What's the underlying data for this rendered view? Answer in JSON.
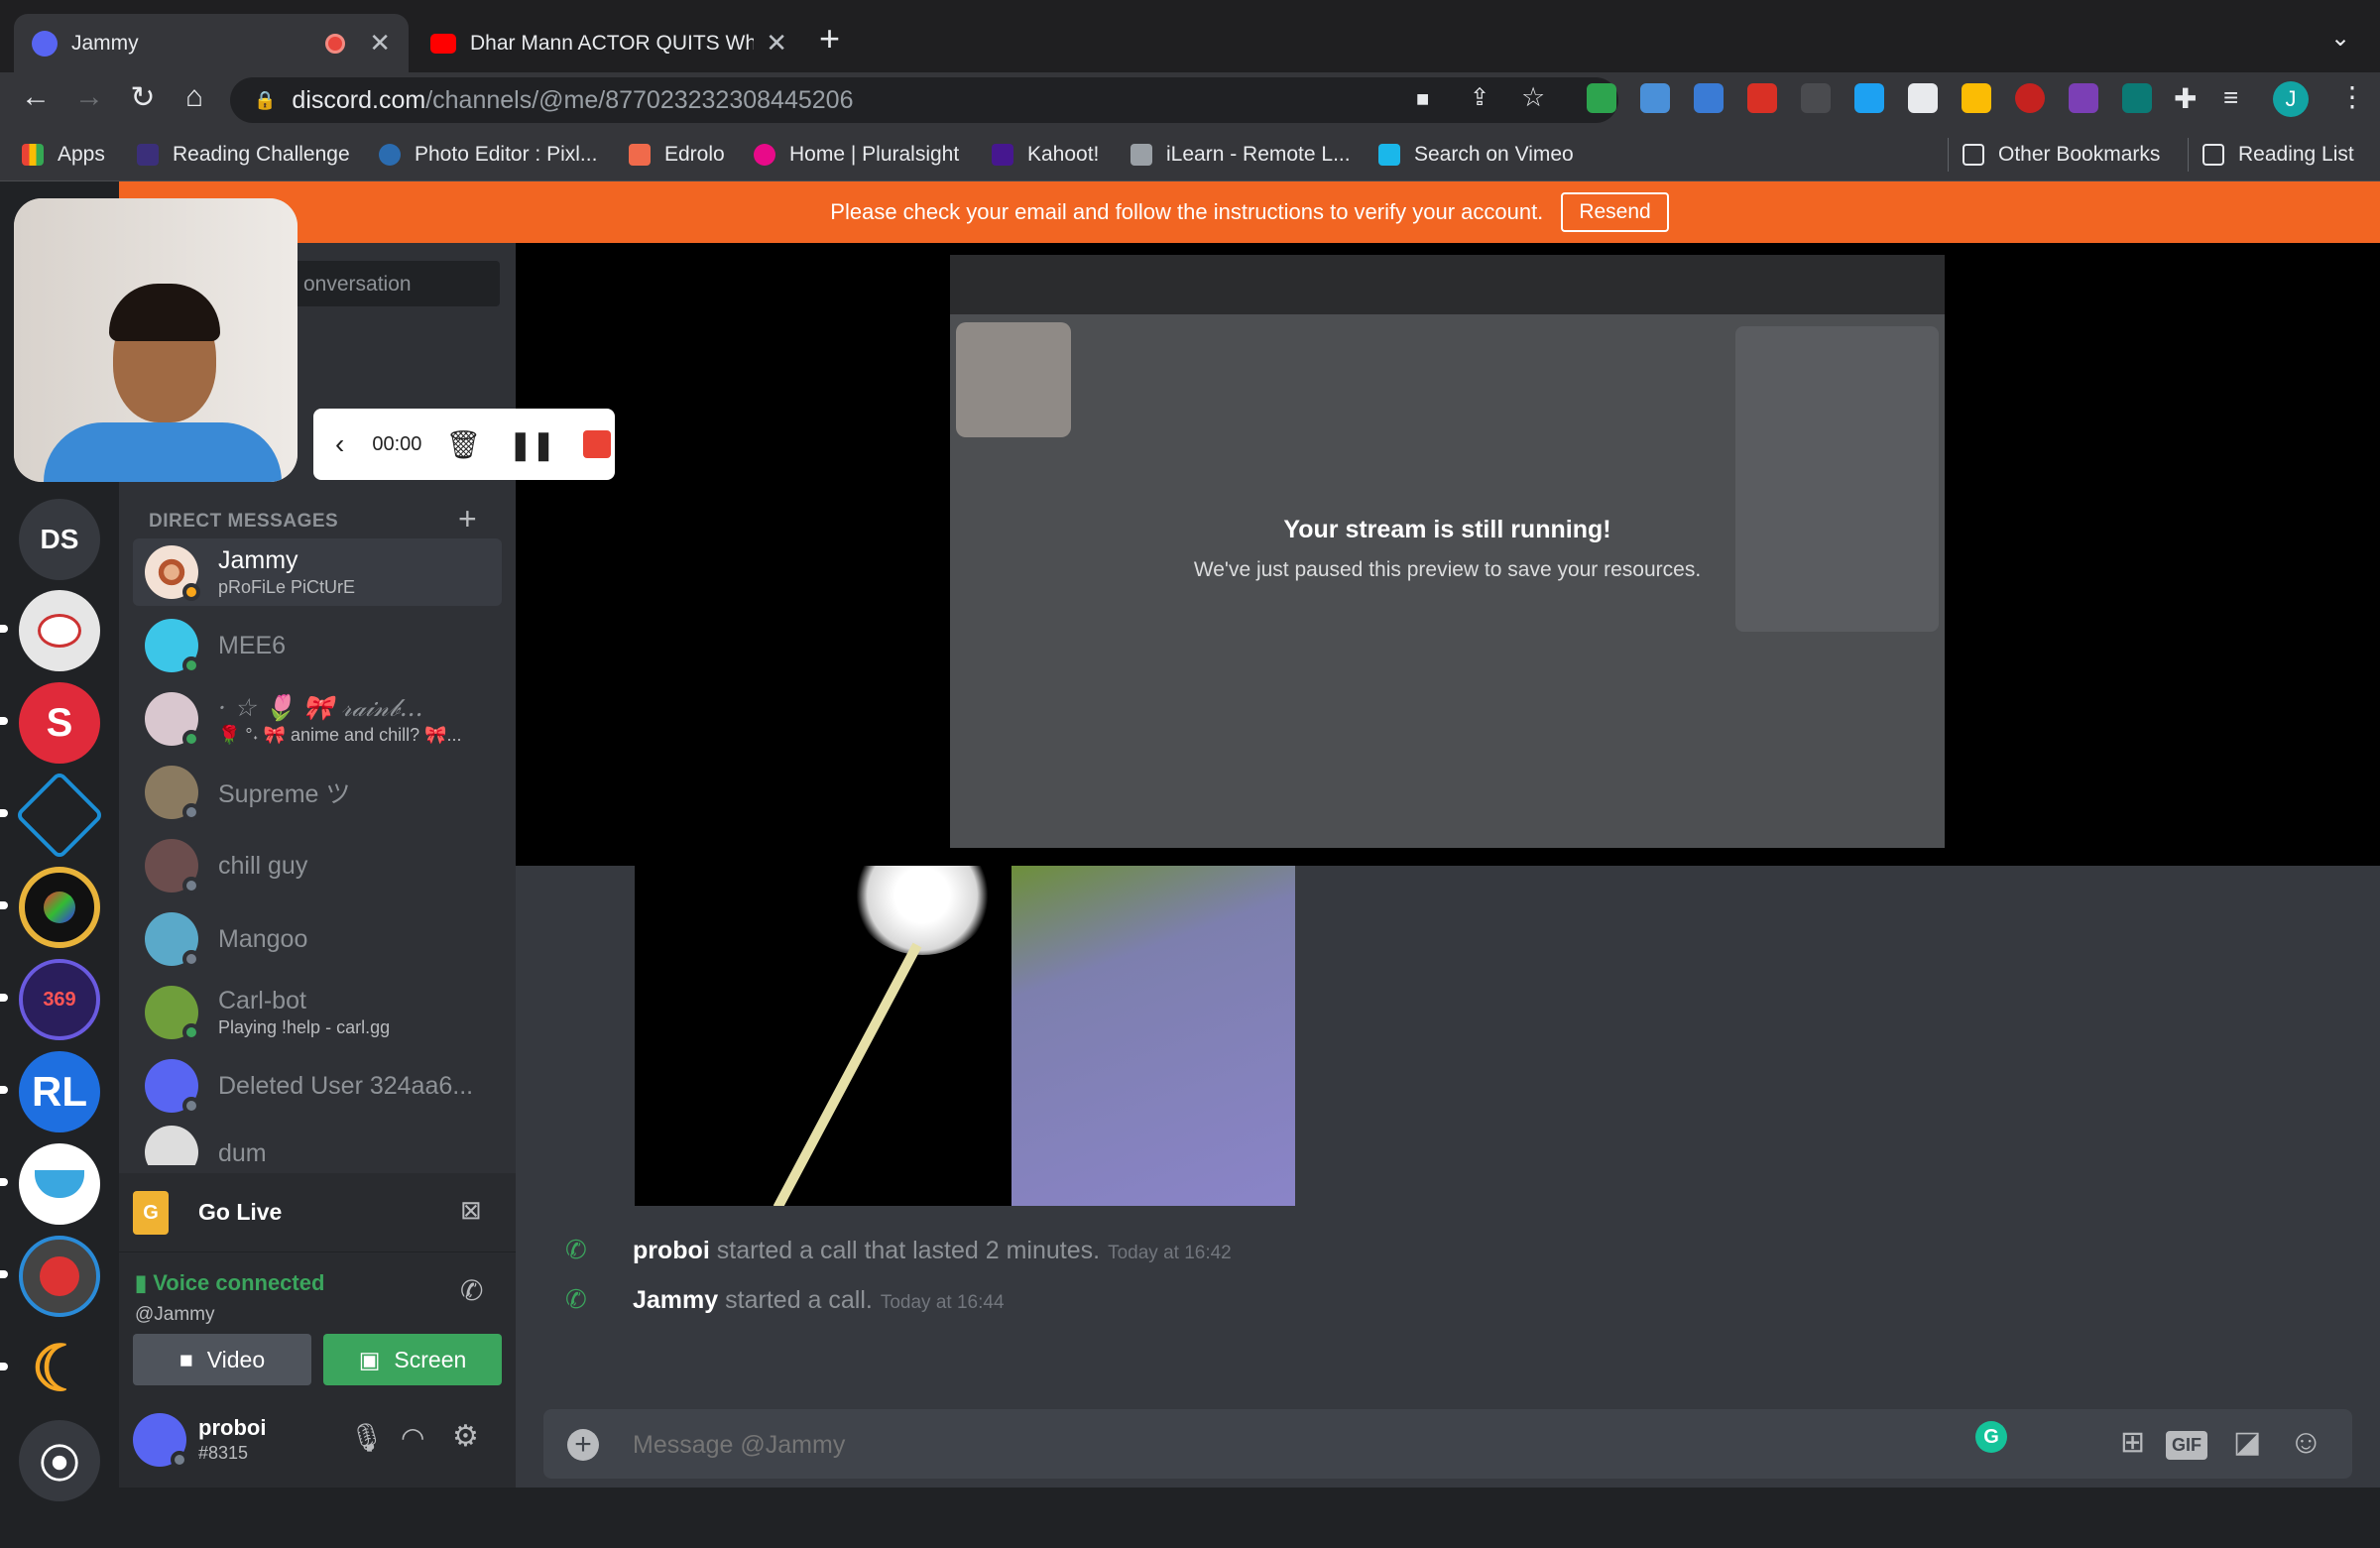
{
  "browser": {
    "tabs": [
      {
        "title": "Jammy",
        "active": true
      },
      {
        "title": "Dhar Mann ACTOR QUITS Whil",
        "active": false
      }
    ],
    "url_host": "discord.com",
    "url_path": "/channels/@me/877023232308445206",
    "profile_initial": "J",
    "bookmarks": [
      "Apps",
      "Reading Challenge",
      "Photo Editor : Pixl...",
      "Edrolo",
      "Home | Pluralsight",
      "Kahoot!",
      "iLearn - Remote L...",
      "Search on Vimeo"
    ],
    "other_bookmarks": "Other Bookmarks",
    "reading_list": "Reading List"
  },
  "banner": {
    "text": "Please check your email and follow the instructions to verify your account.",
    "button": "Resend"
  },
  "servers": {
    "ds_label": "DS"
  },
  "sidebar": {
    "search_placeholder": "onversation",
    "dm_header": "DIRECT MESSAGES",
    "dms": [
      {
        "name": "Jammy",
        "sub": "pRoFiLe PiCtUrE",
        "status": "idle"
      },
      {
        "name": "MEE6",
        "sub": "",
        "status": "online"
      },
      {
        "name": "· ☆ 🌷 🎀 𝓇𝒶𝒾𝓃𝒷...",
        "sub": "🌹 °˖ 🎀 anime and chill? 🎀...",
        "status": "online"
      },
      {
        "name": "Supreme ツ",
        "sub": "",
        "status": "offline"
      },
      {
        "name": "chill guy",
        "sub": "",
        "status": "offline"
      },
      {
        "name": "Mangoo",
        "sub": "",
        "status": "offline"
      },
      {
        "name": "Carl-bot",
        "sub": "Playing !help - carl.gg",
        "status": "online"
      },
      {
        "name": "Deleted User 324aa6...",
        "sub": "",
        "status": "offline"
      },
      {
        "name": "dum",
        "sub": "",
        "status": "offline"
      }
    ],
    "go_live": "Go Live",
    "voice_status": "Voice connected",
    "voice_channel": "@Jammy",
    "video_btn": "Video",
    "screen_btn": "Screen",
    "username": "proboi",
    "discriminator": "#8315"
  },
  "recorder": {
    "time": "00:00"
  },
  "stream": {
    "title": "Your stream is still running!",
    "subtitle": "We've just paused this preview to save your resources."
  },
  "messages": [
    {
      "user": "proboi",
      "text": "started a call that lasted 2 minutes.",
      "time": "Today at 16:42"
    },
    {
      "user": "Jammy",
      "text": "started a call.",
      "time": "Today at 16:44"
    }
  ],
  "composer": {
    "placeholder": "Message @Jammy",
    "gif": "GIF"
  },
  "colors": {
    "banner": "#f26522",
    "online": "#3ba55d",
    "blurple": "#5865f2",
    "screen_btn": "#3ba55d"
  }
}
